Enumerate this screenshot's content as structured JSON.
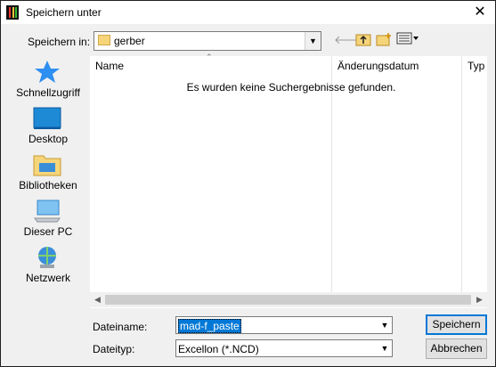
{
  "window": {
    "title": "Speichern unter",
    "close_glyph": "✕"
  },
  "nav": {
    "look_in_label": "Speichern in:",
    "current_folder": "gerber",
    "back_icon": "back-arrow-icon",
    "up_icon": "folder-up-icon",
    "new_folder_icon": "new-folder-icon",
    "view_menu_icon": "view-menu-icon"
  },
  "places": [
    {
      "id": "quick-access",
      "label": "Schnellzugriff",
      "icon": "star-icon"
    },
    {
      "id": "desktop",
      "label": "Desktop",
      "icon": "desktop-icon"
    },
    {
      "id": "libraries",
      "label": "Bibliotheken",
      "icon": "libraries-icon"
    },
    {
      "id": "this-pc",
      "label": "Dieser PC",
      "icon": "computer-icon"
    },
    {
      "id": "network",
      "label": "Netzwerk",
      "icon": "network-icon"
    }
  ],
  "list": {
    "columns": [
      "Name",
      "Änderungsdatum",
      "Typ"
    ],
    "empty_message": "Es wurden keine Suchergebnisse gefunden."
  },
  "form": {
    "filename_label": "Dateiname:",
    "filename_value": "mad-f_paste",
    "filetype_label": "Dateityp:",
    "filetype_value": "Excellon (*.NCD)"
  },
  "buttons": {
    "save": "Speichern",
    "cancel": "Abbrechen"
  },
  "colors": {
    "accent": "#0078d7",
    "star": "#2d8ff0",
    "folder": "#f6d57a"
  }
}
